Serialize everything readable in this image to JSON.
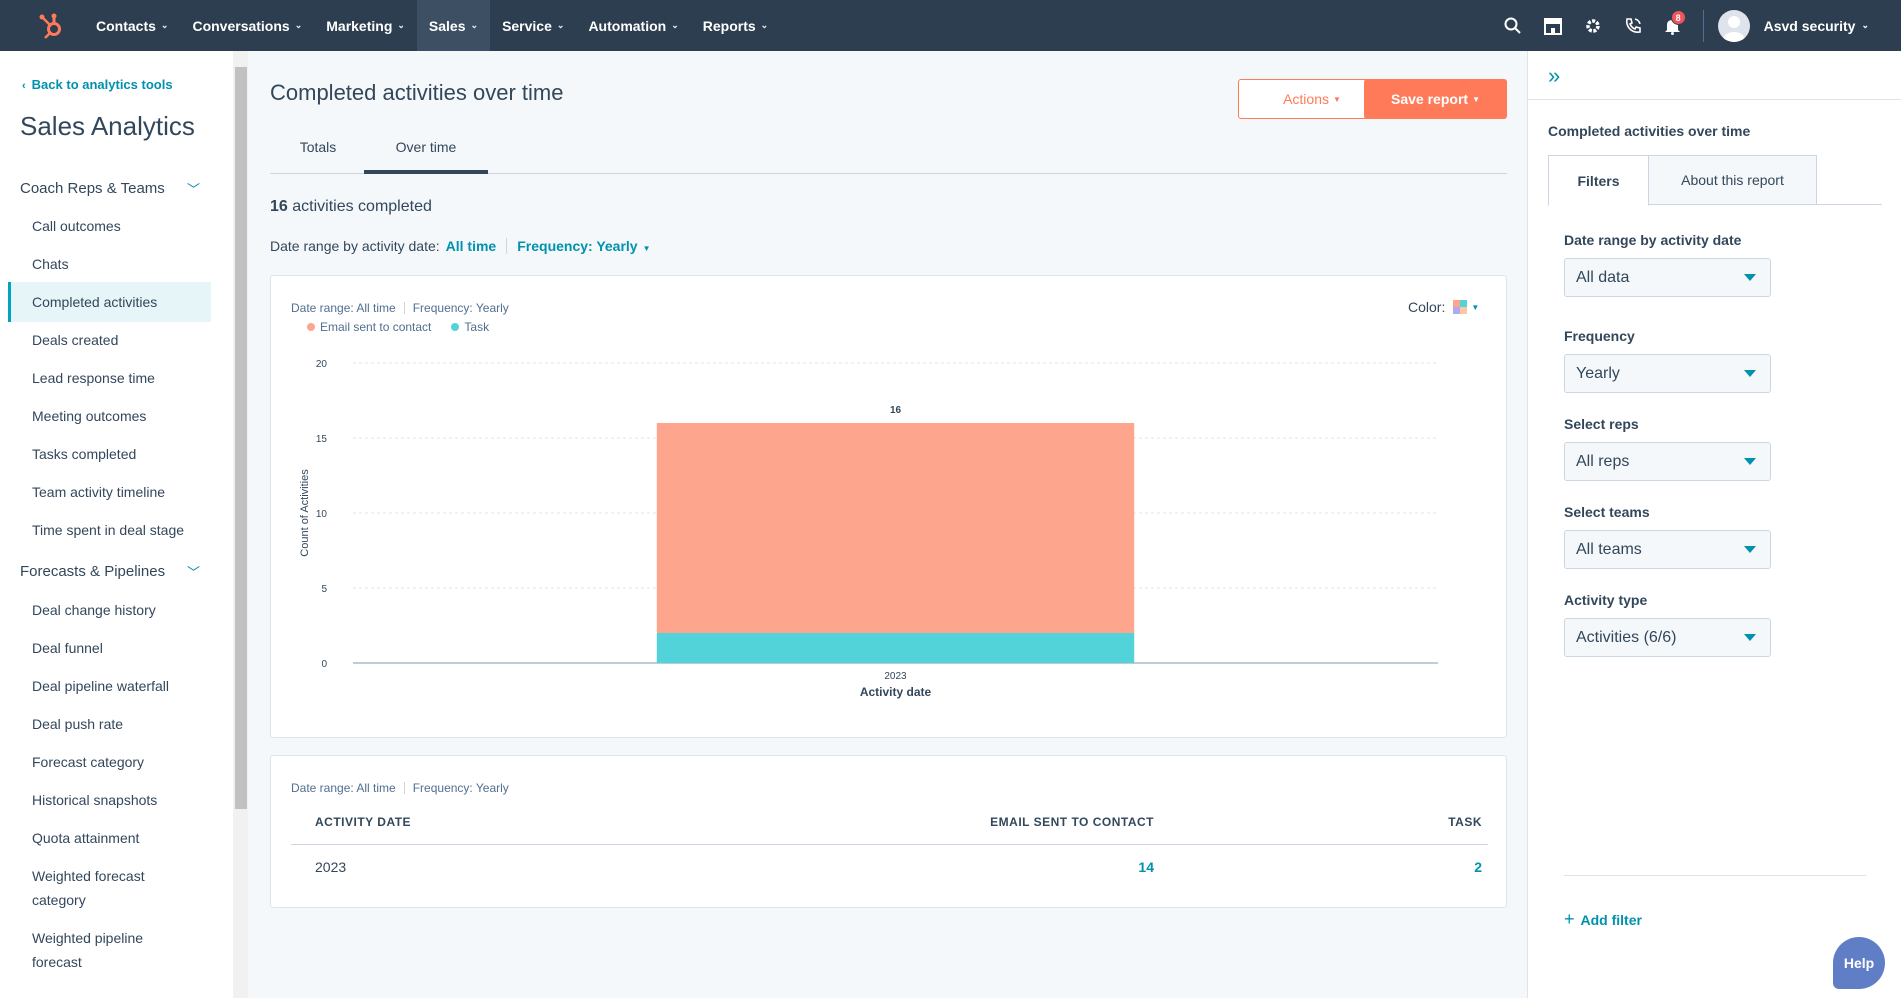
{
  "nav": {
    "items": [
      {
        "label": "Contacts"
      },
      {
        "label": "Conversations"
      },
      {
        "label": "Marketing"
      },
      {
        "label": "Sales"
      },
      {
        "label": "Service"
      },
      {
        "label": "Automation"
      },
      {
        "label": "Reports"
      }
    ],
    "notification_count": "8",
    "user_name": "Asvd security"
  },
  "sidebar": {
    "back_link": "Back to analytics tools",
    "title": "Sales Analytics",
    "sections": [
      {
        "label": "Coach Reps & Teams"
      },
      {
        "label": "Forecasts & Pipelines"
      }
    ],
    "items": [
      {
        "label": "Call outcomes"
      },
      {
        "label": "Chats"
      },
      {
        "label": "Completed activities"
      },
      {
        "label": "Deals created"
      },
      {
        "label": "Lead response time"
      },
      {
        "label": "Meeting outcomes"
      },
      {
        "label": "Tasks completed"
      },
      {
        "label": "Team activity timeline"
      },
      {
        "label": "Time spent in deal stage"
      },
      {
        "label": "Deal change history"
      },
      {
        "label": "Deal funnel"
      },
      {
        "label": "Deal pipeline waterfall"
      },
      {
        "label": "Deal push rate"
      },
      {
        "label": "Forecast category"
      },
      {
        "label": "Historical snapshots"
      },
      {
        "label": "Quota attainment"
      },
      {
        "label": "Weighted forecast"
      },
      {
        "label": "category"
      },
      {
        "label": "Weighted pipeline"
      },
      {
        "label": "forecast"
      }
    ]
  },
  "main": {
    "title": "Completed activities over time",
    "actions_label": "Actions",
    "save_label": "Save report",
    "tabs": [
      {
        "label": "Totals"
      },
      {
        "label": "Over time"
      }
    ],
    "summary_count": "16",
    "summary_text": "activities completed",
    "date_range_label": "Date range by activity date:",
    "date_range_value": "All time",
    "frequency_label": "Frequency: Yearly",
    "meta_date_range": "Date range: All time",
    "meta_frequency": "Frequency: Yearly",
    "color_label": "Color:"
  },
  "chart_data": {
    "type": "bar",
    "stacked": true,
    "categories": [
      "2023"
    ],
    "series": [
      {
        "name": "Email sent to contact",
        "values": [
          14
        ],
        "color": "#fea58e"
      },
      {
        "name": "Task",
        "values": [
          2
        ],
        "color": "#51d3d9"
      }
    ],
    "totals": [
      16
    ],
    "xlabel": "Activity date",
    "ylabel": "Count of Activities",
    "ylim": [
      0,
      20
    ],
    "yticks": [
      0,
      5,
      10,
      15,
      20
    ],
    "grid": true,
    "legend": "top-left"
  },
  "table": {
    "headers": [
      "ACTIVITY DATE",
      "EMAIL SENT TO CONTACT",
      "TASK"
    ],
    "rows": [
      [
        "2023",
        "14",
        "2"
      ]
    ]
  },
  "rightpanel": {
    "title": "Completed activities over time",
    "tabs": [
      {
        "label": "Filters"
      },
      {
        "label": "About this report"
      }
    ],
    "filters": [
      {
        "label": "Date range by activity date",
        "value": "All data"
      },
      {
        "label": "Frequency",
        "value": "Yearly"
      },
      {
        "label": "Select reps",
        "value": "All reps"
      },
      {
        "label": "Select teams",
        "value": "All teams"
      },
      {
        "label": "Activity type",
        "value": "Activities (6/6)"
      }
    ],
    "add_filter": "Add filter"
  },
  "help_label": "Help"
}
